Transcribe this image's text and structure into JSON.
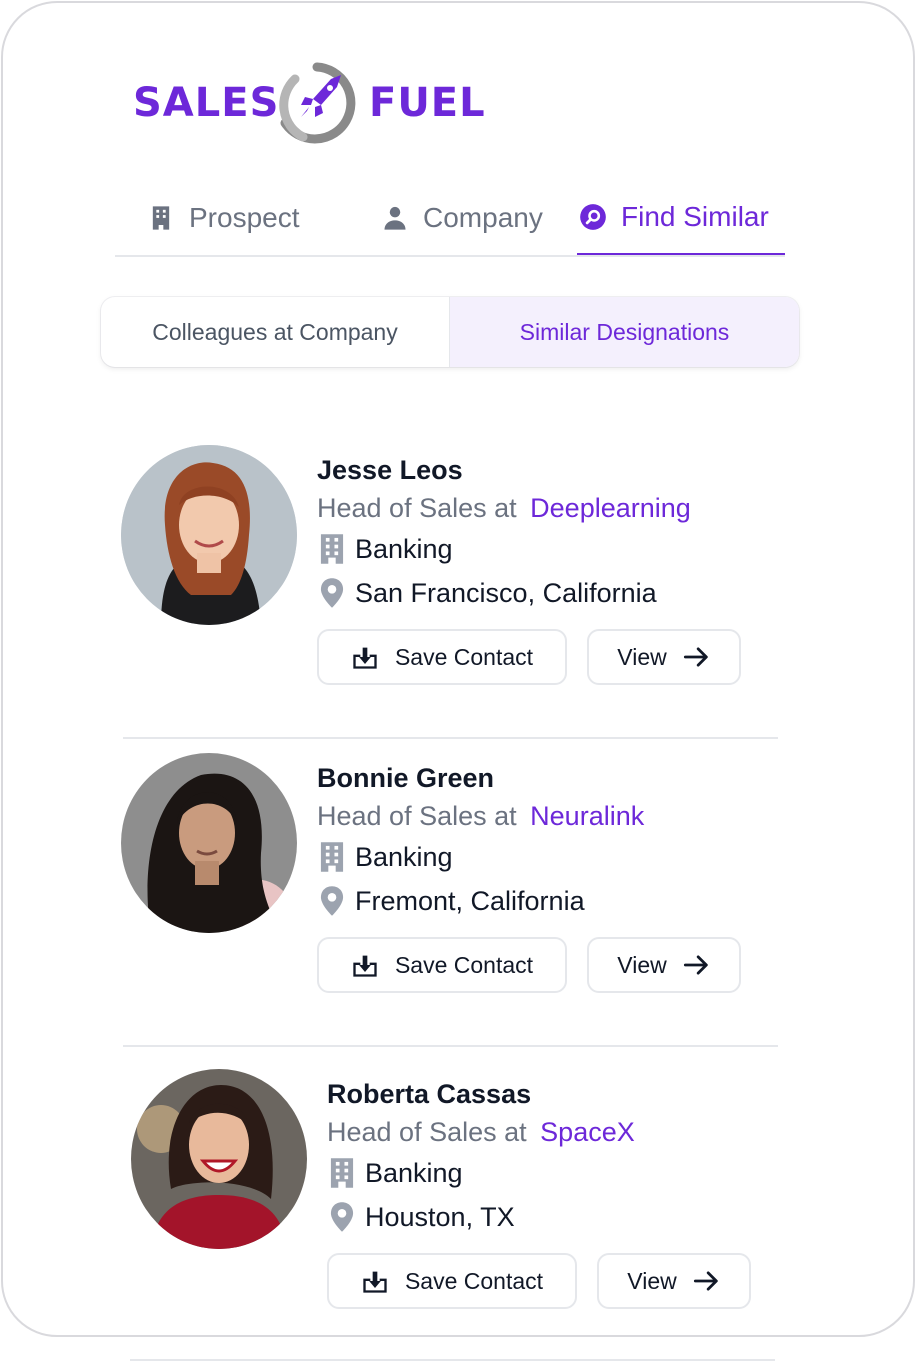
{
  "brand": {
    "name_left": "SALES",
    "name_right": "FUEL",
    "accent_color": "#6d28d9"
  },
  "tabs": [
    {
      "label": "Prospect",
      "icon": "building-icon",
      "active": false
    },
    {
      "label": "Company",
      "icon": "user-icon",
      "active": false
    },
    {
      "label": "Find Similar",
      "icon": "search-circle-icon",
      "active": true
    }
  ],
  "segments": [
    {
      "label": "Colleagues at Company",
      "active": false
    },
    {
      "label": "Similar Designations",
      "active": true
    }
  ],
  "contacts": [
    {
      "name": "Jesse Leos",
      "role": "Head of Sales",
      "at": "at",
      "company": "Deeplearning",
      "industry": "Banking",
      "location": "San Francisco, California",
      "save_label": "Save Contact",
      "view_label": "View"
    },
    {
      "name": "Bonnie Green",
      "role": "Head of Sales",
      "at": "at",
      "company": "Neuralink",
      "industry": "Banking",
      "location": "Fremont, California",
      "save_label": "Save Contact",
      "view_label": "View"
    },
    {
      "name": "Roberta Cassas",
      "role": "Head of Sales",
      "at": "at",
      "company": "SpaceX",
      "industry": "Banking",
      "location": "Houston, TX",
      "save_label": "Save Contact",
      "view_label": "View"
    }
  ]
}
